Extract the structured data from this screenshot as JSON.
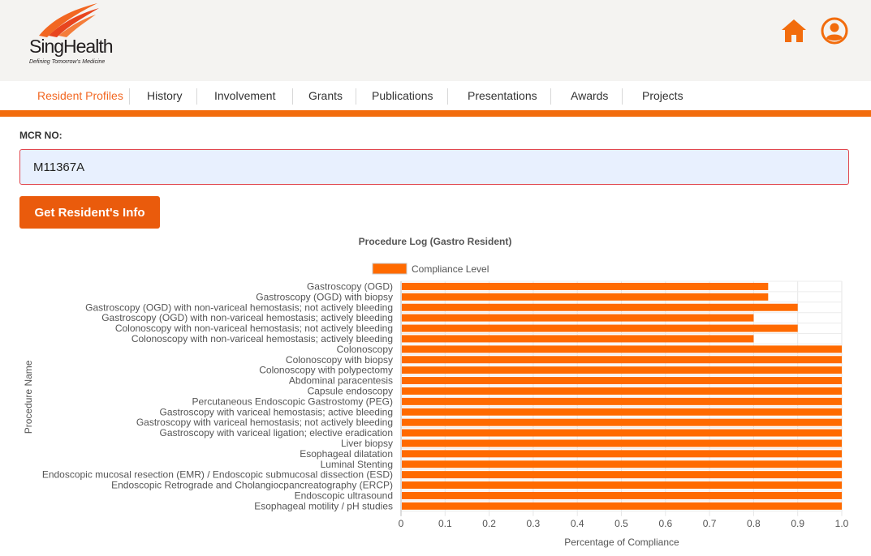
{
  "brand": {
    "name": "SingHealth",
    "tagline": "Defining Tomorrow's Medicine",
    "accent_color": "#f26722",
    "bar_color": "#ff6a00"
  },
  "header": {
    "icons": [
      "home-icon",
      "user-icon"
    ]
  },
  "nav": {
    "items": [
      {
        "label": "Resident Profiles",
        "active": true
      },
      {
        "label": "History",
        "active": false
      },
      {
        "label": "Involvement",
        "active": false
      },
      {
        "label": "Grants",
        "active": false
      },
      {
        "label": "Publications",
        "active": false
      },
      {
        "label": "Presentations",
        "active": false
      },
      {
        "label": "Awards",
        "active": false
      },
      {
        "label": "Projects",
        "active": false
      }
    ]
  },
  "form": {
    "mcr_label": "MCR NO:",
    "mcr_value": "M11367A",
    "button_label": "Get Resident's Info"
  },
  "chart_data": {
    "type": "bar",
    "orientation": "horizontal",
    "title": "Procedure Log (Gastro Resident)",
    "xlabel": "Percentage of Compliance",
    "ylabel": "Procedure Name",
    "xlim": [
      0,
      1.0
    ],
    "xticks": [
      "0",
      "0.1",
      "0.2",
      "0.3",
      "0.4",
      "0.5",
      "0.6",
      "0.7",
      "0.8",
      "0.9",
      "1.0"
    ],
    "legend_position": "top",
    "grid": true,
    "series": [
      {
        "name": "Compliance Level",
        "color": "#ff6a00",
        "values": [
          0.833,
          0.833,
          0.9,
          0.8,
          0.9,
          0.8,
          1.0,
          1.0,
          1.0,
          1.0,
          1.0,
          1.0,
          1.0,
          1.0,
          1.0,
          1.0,
          1.0,
          1.0,
          1.0,
          1.0,
          1.0,
          1.0
        ]
      }
    ],
    "categories": [
      "Gastroscopy (OGD)",
      "Gastroscopy (OGD) with biopsy",
      "Gastroscopy (OGD) with non-variceal hemostasis; not actively bleeding",
      "Gastroscopy (OGD) with non-variceal hemostasis; actively bleeding",
      "Colonoscopy with non-variceal hemostasis; not actively bleeding",
      "Colonoscopy with non-variceal hemostasis; actively bleeding",
      "Colonoscopy",
      "Colonoscopy with biopsy",
      "Colonoscopy with polypectomy",
      "Abdominal paracentesis",
      "Capsule endoscopy",
      "Percutaneous Endoscopic Gastrostomy (PEG)",
      "Gastroscopy with variceal hemostasis; active bleeding",
      "Gastroscopy with variceal hemostasis; not actively bleeding",
      "Gastroscopy with variceal ligation; elective eradication",
      "Liver biopsy",
      "Esophageal dilatation",
      "Luminal Stenting",
      "Endoscopic mucosal resection (EMR) / Endoscopic submucosal dissection (ESD)",
      "Endoscopic Retrograde and Cholangiocpancreatography (ERCP)",
      "Endoscopic ultrasound",
      "Esophageal motility / pH studies"
    ]
  }
}
